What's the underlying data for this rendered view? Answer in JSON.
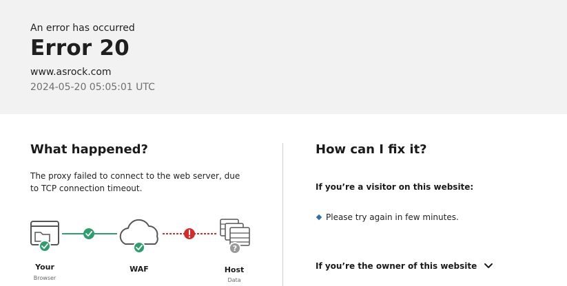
{
  "header": {
    "subtitle": "An error has occurred",
    "error_code": "Error 20",
    "site": "www.asrock.com",
    "timestamp": "2024-05-20 05:05:01 UTC"
  },
  "what_happened": {
    "title": "What happened?",
    "description": "The proxy failed to connect to the web server, due to TCP connection timeout."
  },
  "diagram": {
    "nodes": [
      {
        "name": "Your",
        "sub": "Browser",
        "status": "ok"
      },
      {
        "name": "WAF",
        "sub": "",
        "status": "ok"
      },
      {
        "name": "Host",
        "sub": "Data",
        "status": "unknown"
      }
    ],
    "links": [
      {
        "status": "ok",
        "color": "#2e9e6e"
      },
      {
        "status": "error",
        "color": "#d42b2b"
      }
    ]
  },
  "fix": {
    "title": "How can I fix it?",
    "visitor_heading": "If you’re a visitor on this website:",
    "visitor_tip": "Please try again in few minutes.",
    "owner_heading": "If you’re the owner of this website"
  },
  "colors": {
    "ok": "#2e9e6e",
    "error": "#d42b2b",
    "unknown": "#9a9a9a",
    "bullet": "#2f6eb5"
  }
}
